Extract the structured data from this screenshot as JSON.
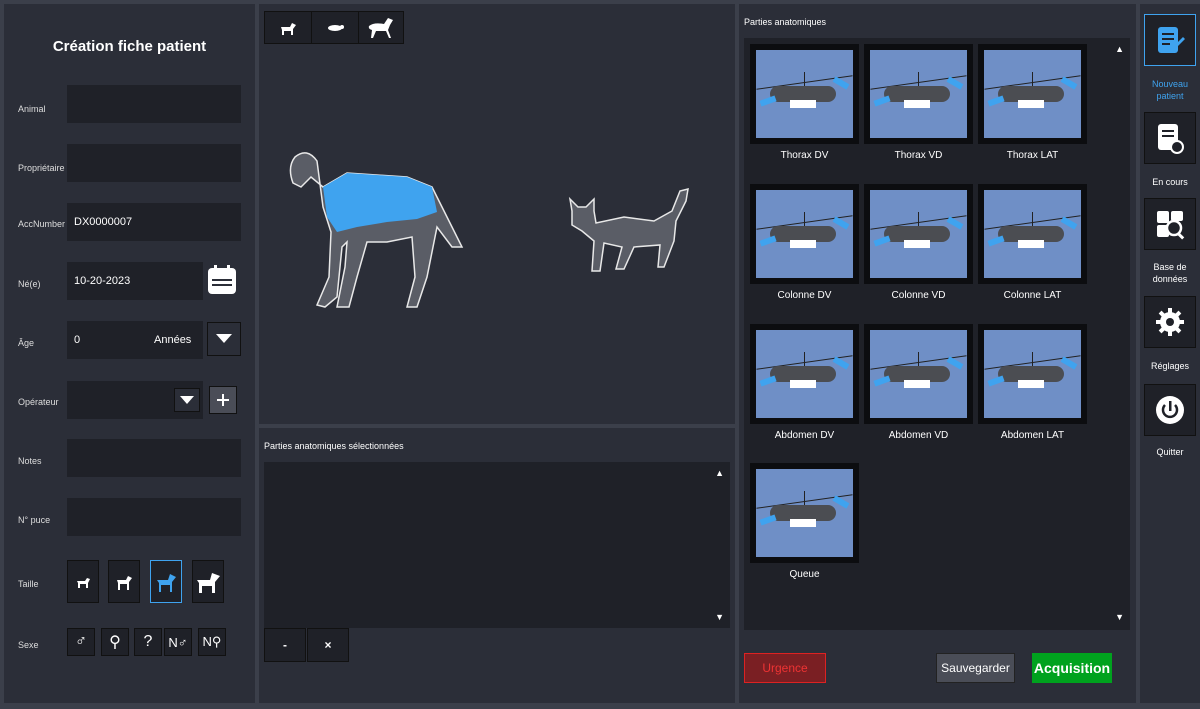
{
  "form": {
    "title": "Création fiche patient",
    "fields": [
      {
        "label": "Animal",
        "value": ""
      },
      {
        "label": "Propriétaire",
        "value": ""
      },
      {
        "label": "AccNumber",
        "value": "DX0000007"
      },
      {
        "label": "Né(e)",
        "value": "10-20-2023"
      },
      {
        "label": "Âge",
        "value": "0"
      },
      {
        "label": "Opérateur",
        "value": ""
      },
      {
        "label": "Notes",
        "value": ""
      },
      {
        "label": "N° puce",
        "value": ""
      }
    ],
    "age_unit": "Années",
    "size_label": "Taille",
    "sex_label": "Sexe",
    "sex_options": [
      "♂",
      "⚲",
      "?",
      "N♂",
      "N⚲"
    ]
  },
  "species": {
    "buttons": [
      "dog-icon",
      "turtle-icon",
      "horse-icon"
    ]
  },
  "selected": {
    "title": "Parties anatomiques sélectionnées",
    "remove_label": "-",
    "clear_label": "×"
  },
  "parts": {
    "title": "Parties anatomiques",
    "items": [
      "Thorax DV",
      "Thorax VD",
      "Thorax LAT",
      "Colonne DV",
      "Colonne VD",
      "Colonne LAT",
      "Abdomen DV",
      "Abdomen VD",
      "Abdomen LAT",
      "Queue"
    ]
  },
  "actions": {
    "urgence": "Urgence",
    "save": "Sauvegarder",
    "acquisition": "Acquisition"
  },
  "rail": {
    "new": "Nouveau patient",
    "ongoing": "En cours",
    "database": "Base de données",
    "settings": "Réglages",
    "quit": "Quitter"
  },
  "colors": {
    "accent": "#3fa3ef",
    "urgent": "#dd2222",
    "acquisition": "#00a21e"
  }
}
